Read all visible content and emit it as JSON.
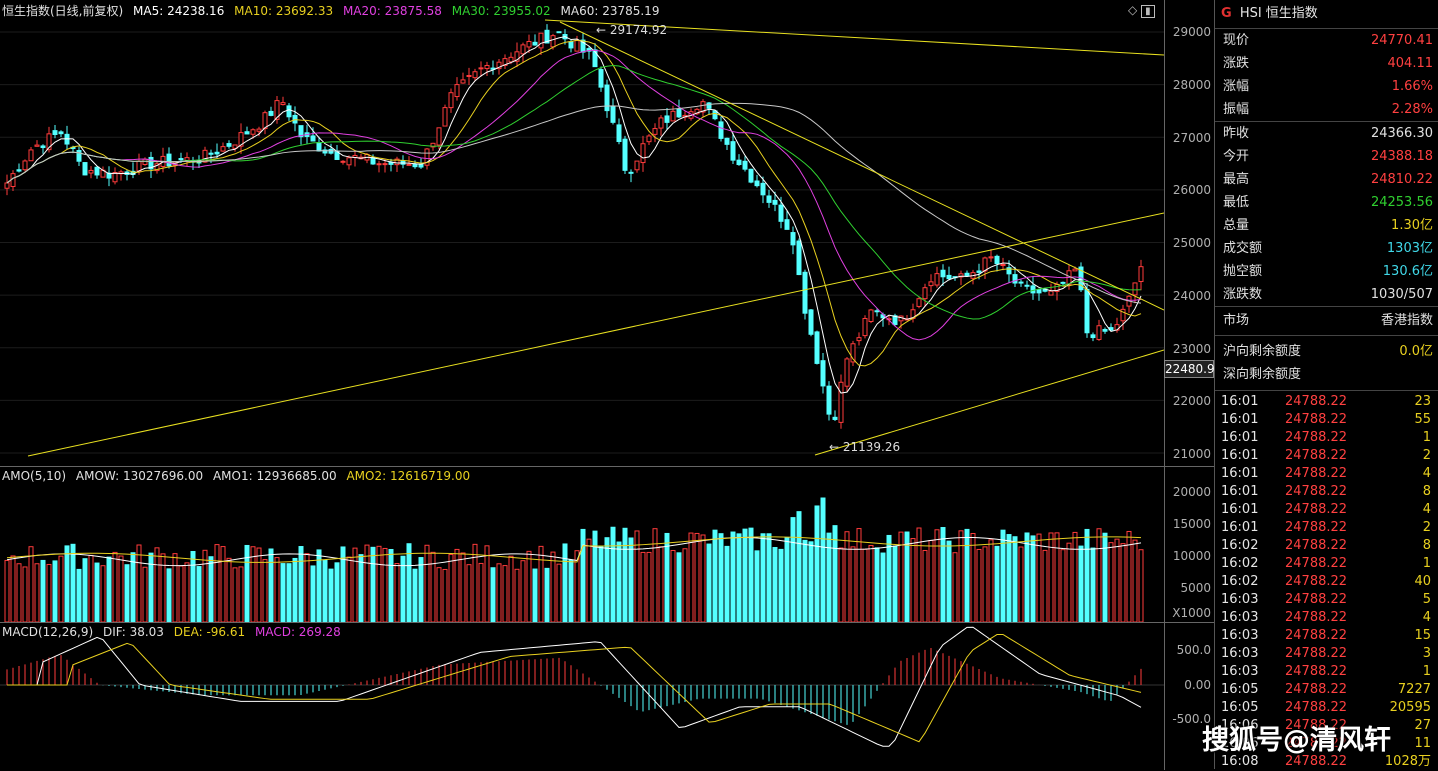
{
  "main_legend": {
    "title": "恒生指数(日线,前复权)",
    "ma5": "MA5: 24238.16",
    "ma10": "MA10: 23692.33",
    "ma20": "MA20: 23875.58",
    "ma30": "MA30: 23955.02",
    "ma60": "MA60: 23785.19"
  },
  "main_axis": [
    "29000",
    "28000",
    "27000",
    "26000",
    "25000",
    "24000",
    "23000",
    "22000",
    "21000"
  ],
  "annotations": {
    "high": "29174.92",
    "low": "21139.26",
    "cursor_price": "22480.9"
  },
  "vol_legend": {
    "title": "AMO(5,10)",
    "amow": "AMOW: 13027696.00",
    "amo1": "AMO1: 12936685.00",
    "amo2": "AMO2: 12616719.00"
  },
  "vol_axis": [
    "20000",
    "15000",
    "10000",
    "5000",
    "X1000"
  ],
  "macd_legend": {
    "title": "MACD(12,26,9)",
    "dif": "DIF: 38.03",
    "dea": "DEA: -96.61",
    "macd": "MACD: 269.28"
  },
  "macd_axis": [
    "500.0",
    "0.00",
    "-500.0"
  ],
  "sidebar": {
    "badge": "G",
    "title": "HSI 恒生指数",
    "quote": [
      {
        "k": "现价",
        "v": "24770.41",
        "c": "#ff4040"
      },
      {
        "k": "涨跌",
        "v": "404.11",
        "c": "#ff4040"
      },
      {
        "k": "涨幅",
        "v": "1.66%",
        "c": "#ff4040"
      },
      {
        "k": "振幅",
        "v": "2.28%",
        "c": "#ff4040"
      }
    ],
    "stats": [
      {
        "k": "昨收",
        "v": "24366.30",
        "c": "#e0e0e0"
      },
      {
        "k": "今开",
        "v": "24388.18",
        "c": "#ff4040"
      },
      {
        "k": "最高",
        "v": "24810.22",
        "c": "#ff4040"
      },
      {
        "k": "最低",
        "v": "24253.56",
        "c": "#30d030"
      },
      {
        "k": "总量",
        "v": "1.30亿",
        "c": "#e8d020"
      },
      {
        "k": "成交额",
        "v": "1303亿",
        "c": "#40d8e8"
      },
      {
        "k": "抛空额",
        "v": "130.6亿",
        "c": "#40d8e8"
      },
      {
        "k": "涨跌数",
        "v": "1030/507",
        "c": "#e0e0e0"
      }
    ],
    "market": {
      "k": "市场",
      "v": "香港指数"
    },
    "flows": [
      {
        "k": "沪向剩余额度",
        "v": "0.0亿",
        "c": "#e8d020"
      },
      {
        "k": "深向剩余额度",
        "v": "",
        "c": "#e8d020"
      }
    ],
    "ticks": [
      {
        "t": "16:01",
        "p": "24788.22",
        "v": "23"
      },
      {
        "t": "16:01",
        "p": "24788.22",
        "v": "55"
      },
      {
        "t": "16:01",
        "p": "24788.22",
        "v": "1"
      },
      {
        "t": "16:01",
        "p": "24788.22",
        "v": "2"
      },
      {
        "t": "16:01",
        "p": "24788.22",
        "v": "4"
      },
      {
        "t": "16:01",
        "p": "24788.22",
        "v": "8"
      },
      {
        "t": "16:01",
        "p": "24788.22",
        "v": "4"
      },
      {
        "t": "16:01",
        "p": "24788.22",
        "v": "2"
      },
      {
        "t": "16:02",
        "p": "24788.22",
        "v": "8"
      },
      {
        "t": "16:02",
        "p": "24788.22",
        "v": "1"
      },
      {
        "t": "16:02",
        "p": "24788.22",
        "v": "40"
      },
      {
        "t": "16:03",
        "p": "24788.22",
        "v": "5"
      },
      {
        "t": "16:03",
        "p": "24788.22",
        "v": "4"
      },
      {
        "t": "16:03",
        "p": "24788.22",
        "v": "15"
      },
      {
        "t": "16:03",
        "p": "24788.22",
        "v": "3"
      },
      {
        "t": "16:03",
        "p": "24788.22",
        "v": "1"
      },
      {
        "t": "16:05",
        "p": "24788.22",
        "v": "7227"
      },
      {
        "t": "16:05",
        "p": "24788.22",
        "v": "20595"
      },
      {
        "t": "16:06",
        "p": "24788.22",
        "v": "27"
      },
      {
        "t": "16:06",
        "p": "24788.22",
        "v": "11"
      },
      {
        "t": "16:08",
        "p": "24788.22",
        "v": "1028万"
      }
    ]
  },
  "watermark": "搜狐号@清风轩",
  "colors": {
    "up": "#ff3b3b",
    "down": "#54ffff",
    "ma5": "#ffffff",
    "ma10": "#e8d020",
    "ma20": "#e040e0",
    "ma30": "#30d030",
    "ma60": "#c8c8c8",
    "trend": "#e8e020"
  }
}
